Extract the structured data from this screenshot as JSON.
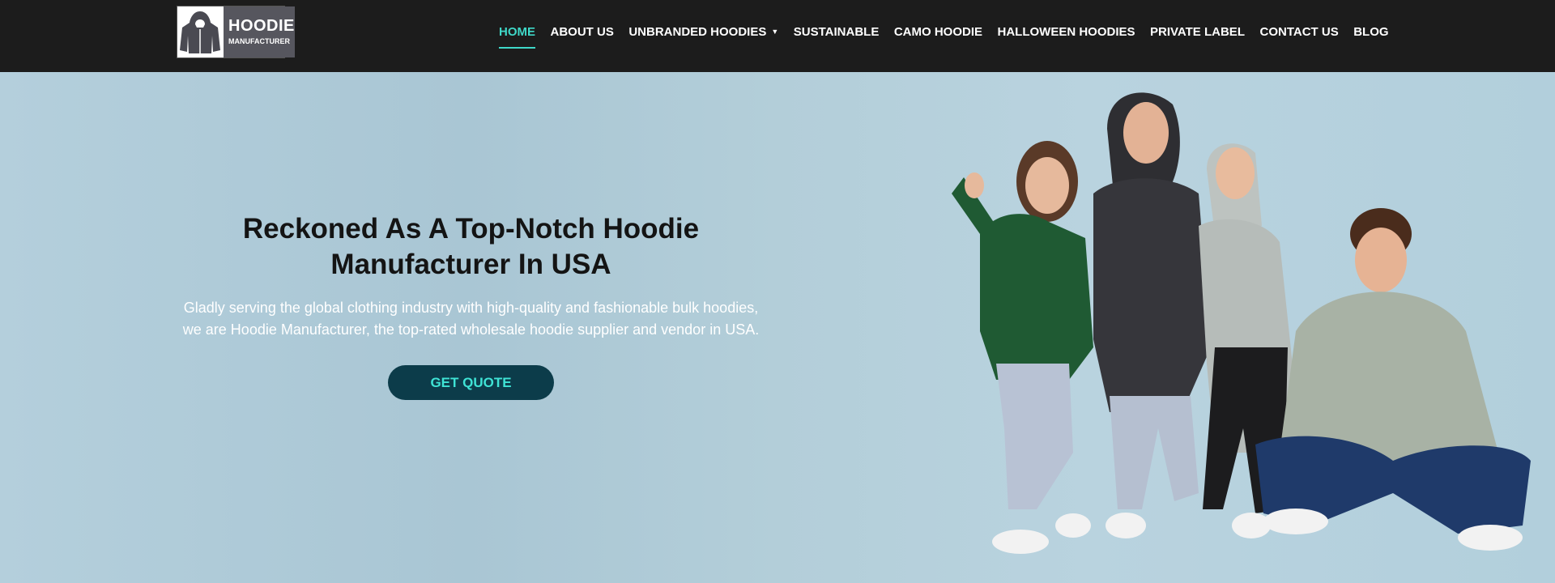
{
  "logo": {
    "line1": "HOODIE",
    "line2": "MANUFACTURER"
  },
  "nav": {
    "home": "HOME",
    "about": "ABOUT US",
    "unbranded": "UNBRANDED HOODIES",
    "sustainable": "SUSTAINABLE",
    "camo": "CAMO HOODIE",
    "halloween": "HALLOWEEN HOODIES",
    "private": "PRIVATE LABEL",
    "contact": "CONTACT US",
    "blog": "BLOG"
  },
  "hero": {
    "title_line1": "Reckoned As A Top-Notch Hoodie",
    "title_line2": "Manufacturer In USA",
    "subtitle": "Gladly serving the global clothing industry with high-quality and fashionable bulk hoodies, we are Hoodie Manufacturer, the top-rated wholesale hoodie supplier and vendor in USA.",
    "cta": "GET QUOTE"
  },
  "colors": {
    "topbar": "#1c1c1c",
    "accent": "#3fd8c8",
    "cta_bg": "#0c3c4a",
    "hero_bg": "#b4cfdc"
  },
  "icons": {
    "logo_mark": "hoodie-icon",
    "dropdown": "caret-down-icon"
  }
}
